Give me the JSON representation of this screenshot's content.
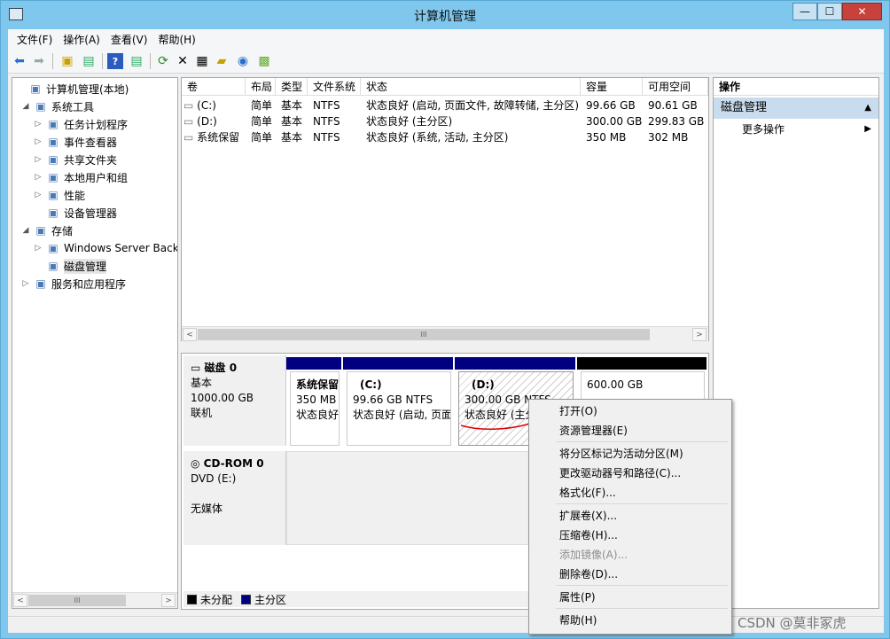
{
  "window": {
    "title": "计算机管理",
    "min": "—",
    "max": "☐",
    "close": "✕"
  },
  "menu": [
    "文件(F)",
    "操作(A)",
    "查看(V)",
    "帮助(H)"
  ],
  "toolbar": [
    "back-icon",
    "forward-icon",
    "up-folder-icon",
    "show-hide-tree-icon",
    "help-icon",
    "show-hide-action-icon",
    "refresh-icon",
    "delete-icon",
    "properties-icon",
    "open-icon",
    "search-icon",
    "export-icon"
  ],
  "tree": [
    {
      "label": "计算机管理(本地)",
      "level": 0,
      "arrow": "",
      "icon": "computer-management-icon"
    },
    {
      "label": "系统工具",
      "level": 1,
      "arrow": "◢",
      "icon": "system-tools-icon"
    },
    {
      "label": "任务计划程序",
      "level": 2,
      "arrow": "▷",
      "icon": "task-scheduler-icon"
    },
    {
      "label": "事件查看器",
      "level": 2,
      "arrow": "▷",
      "icon": "event-viewer-icon"
    },
    {
      "label": "共享文件夹",
      "level": 2,
      "arrow": "▷",
      "icon": "shared-folders-icon"
    },
    {
      "label": "本地用户和组",
      "level": 2,
      "arrow": "▷",
      "icon": "users-groups-icon"
    },
    {
      "label": "性能",
      "level": 2,
      "arrow": "▷",
      "icon": "performance-icon"
    },
    {
      "label": "设备管理器",
      "level": 2,
      "arrow": "",
      "icon": "device-manager-icon"
    },
    {
      "label": "存储",
      "level": 1,
      "arrow": "◢",
      "icon": "storage-icon"
    },
    {
      "label": "Windows Server Back",
      "level": 2,
      "arrow": "▷",
      "icon": "windows-server-backup-icon"
    },
    {
      "label": "磁盘管理",
      "level": 2,
      "arrow": "",
      "icon": "disk-management-icon"
    },
    {
      "label": "服务和应用程序",
      "level": 1,
      "arrow": "▷",
      "icon": "services-apps-icon"
    }
  ],
  "volumes": {
    "columns": [
      "卷",
      "布局",
      "类型",
      "文件系统",
      "状态",
      "容量",
      "可用空间"
    ],
    "rows": [
      [
        "(C:)",
        "简单",
        "基本",
        "NTFS",
        "状态良好 (启动, 页面文件, 故障转储, 主分区)",
        "99.66 GB",
        "90.61 GB"
      ],
      [
        "(D:)",
        "简单",
        "基本",
        "NTFS",
        "状态良好 (主分区)",
        "300.00 GB",
        "299.83 GB"
      ],
      [
        "系统保留",
        "简单",
        "基本",
        "NTFS",
        "状态良好 (系统, 活动, 主分区)",
        "350 MB",
        "302 MB"
      ]
    ]
  },
  "scroll": {
    "left": "<",
    "right": ">",
    "thumb": "III"
  },
  "disk0": {
    "name": "磁盘 0",
    "type": "基本",
    "size": "1000.00 GB",
    "state": "联机",
    "partitions": [
      {
        "name": "系统保留",
        "size": "350 MB",
        "status": "状态良好"
      },
      {
        "name": "(C:)",
        "size": "99.66 GB NTFS",
        "status": "状态良好 (启动, 页面"
      },
      {
        "name": "(D:)",
        "size": "300.00 GB NTFS",
        "status": "状态良好 (主分"
      },
      {
        "name": "",
        "size": "600.00 GB",
        "status": ""
      }
    ]
  },
  "cdrom": {
    "name": "CD-ROM 0",
    "type": "DVD (E:)",
    "state": "无媒体"
  },
  "legend": {
    "unallocated": "未分配",
    "primary": "主分区"
  },
  "actions": {
    "header": "操作",
    "section": "磁盘管理",
    "more": "更多操作"
  },
  "context_menu": [
    {
      "label": "打开(O)",
      "enabled": true
    },
    {
      "label": "资源管理器(E)",
      "enabled": true
    },
    {
      "label": "将分区标记为活动分区(M)",
      "enabled": true
    },
    {
      "label": "更改驱动器号和路径(C)...",
      "enabled": true
    },
    {
      "label": "格式化(F)...",
      "enabled": true
    },
    {
      "label": "扩展卷(X)...",
      "enabled": true
    },
    {
      "label": "压缩卷(H)...",
      "enabled": true
    },
    {
      "label": "添加镜像(A)...",
      "enabled": false
    },
    {
      "label": "删除卷(D)...",
      "enabled": true
    },
    {
      "label": "属性(P)",
      "enabled": true
    },
    {
      "label": "帮助(H)",
      "enabled": true
    }
  ],
  "watermark": "CSDN @莫非冢虎",
  "colors": {
    "titlebar": "#7fc7ec",
    "primary_partition": "#000080",
    "unallocated": "#000000",
    "annotation": "#e00000"
  }
}
